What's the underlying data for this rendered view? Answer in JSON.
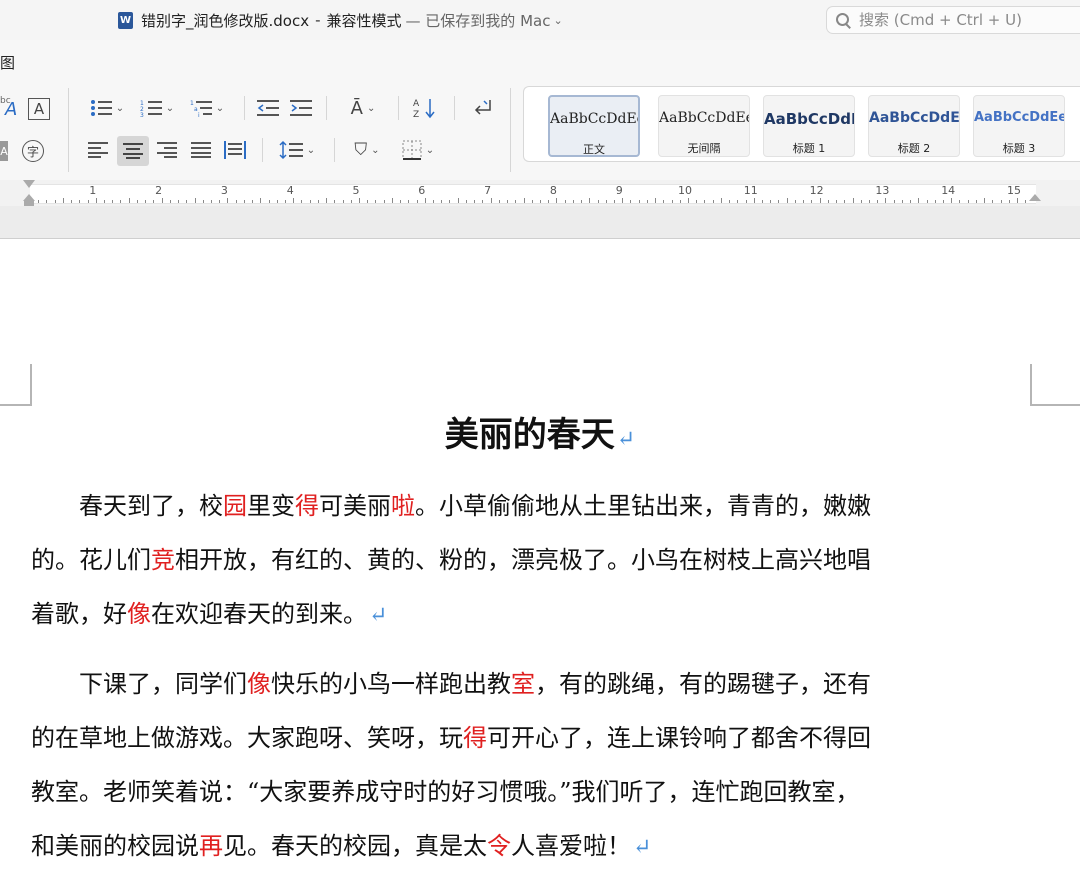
{
  "window": {
    "file_name": "错别字_润色修改版.docx",
    "separator": "-",
    "mode": "兼容性模式",
    "saved_status": "— 已保存到我的 Mac",
    "app_icon_letter": "W"
  },
  "search": {
    "placeholder": "搜索 (Cmd + Ctrl + U)"
  },
  "ribbon": {
    "tab_fragment": "图",
    "char_fragment": "字",
    "styles": [
      {
        "sample": "AaBbCcDdEe",
        "name": "正文"
      },
      {
        "sample": "AaBbCcDdEe",
        "name": "无间隔"
      },
      {
        "sample": "AaBbCcDdI",
        "name": "标题 1"
      },
      {
        "sample": "AaBbCcDdEe",
        "name": "标题 2"
      },
      {
        "sample": "AaBbCcDdEe",
        "name": "标题 3"
      }
    ],
    "selected_style": "正文"
  },
  "ruler": {
    "numbers": [
      "1",
      "2",
      "3",
      "4",
      "5",
      "6",
      "7",
      "8",
      "9",
      "10",
      "11",
      "12",
      "13",
      "14",
      "15"
    ]
  },
  "document": {
    "title": "美丽的春天",
    "paragraph_mark": "↵",
    "paragraphs": [
      [
        [
          [
            "　　春天到了，校",
            false
          ],
          [
            "园",
            true
          ],
          [
            "里变",
            false
          ],
          [
            "得",
            true
          ],
          [
            "可美丽",
            false
          ],
          [
            "啦",
            true
          ],
          [
            "。小草偷偷地从土里钻出来，青青的，嫩嫩",
            false
          ]
        ],
        [
          [
            "的。花儿们",
            false
          ],
          [
            "竞",
            true
          ],
          [
            "相开放，有红的、黄的、粉的，漂亮极了。小鸟在树枝上高兴地唱",
            false
          ]
        ],
        [
          [
            "着歌，好",
            false
          ],
          [
            "像",
            true
          ],
          [
            "在欢迎春天的到来。",
            false
          ]
        ]
      ],
      [
        [
          [
            "　　下课了，同学们",
            false
          ],
          [
            "像",
            true
          ],
          [
            "快乐的小鸟一样跑出教",
            false
          ],
          [
            "室",
            true
          ],
          [
            "，有的跳绳，有的踢毽子，还有",
            false
          ]
        ],
        [
          [
            "的在草地上做游戏。大家跑呀、笑呀，玩",
            false
          ],
          [
            "得",
            true
          ],
          [
            "可开心了，连上课铃响了都舍不得回",
            false
          ]
        ],
        [
          [
            "教室。老师笑着说：“大家要养成守时的好习惯哦。”我们听了，连忙跑回教室，",
            false
          ]
        ],
        [
          [
            "和美丽的校园说",
            false
          ],
          [
            "再",
            true
          ],
          [
            "见。春天的校园，真是太",
            false
          ],
          [
            "令",
            true
          ],
          [
            "人喜爱啦！",
            false
          ]
        ]
      ]
    ],
    "highlight_color": "#e02020",
    "paragraph_mark_color": "#4a90d9"
  }
}
